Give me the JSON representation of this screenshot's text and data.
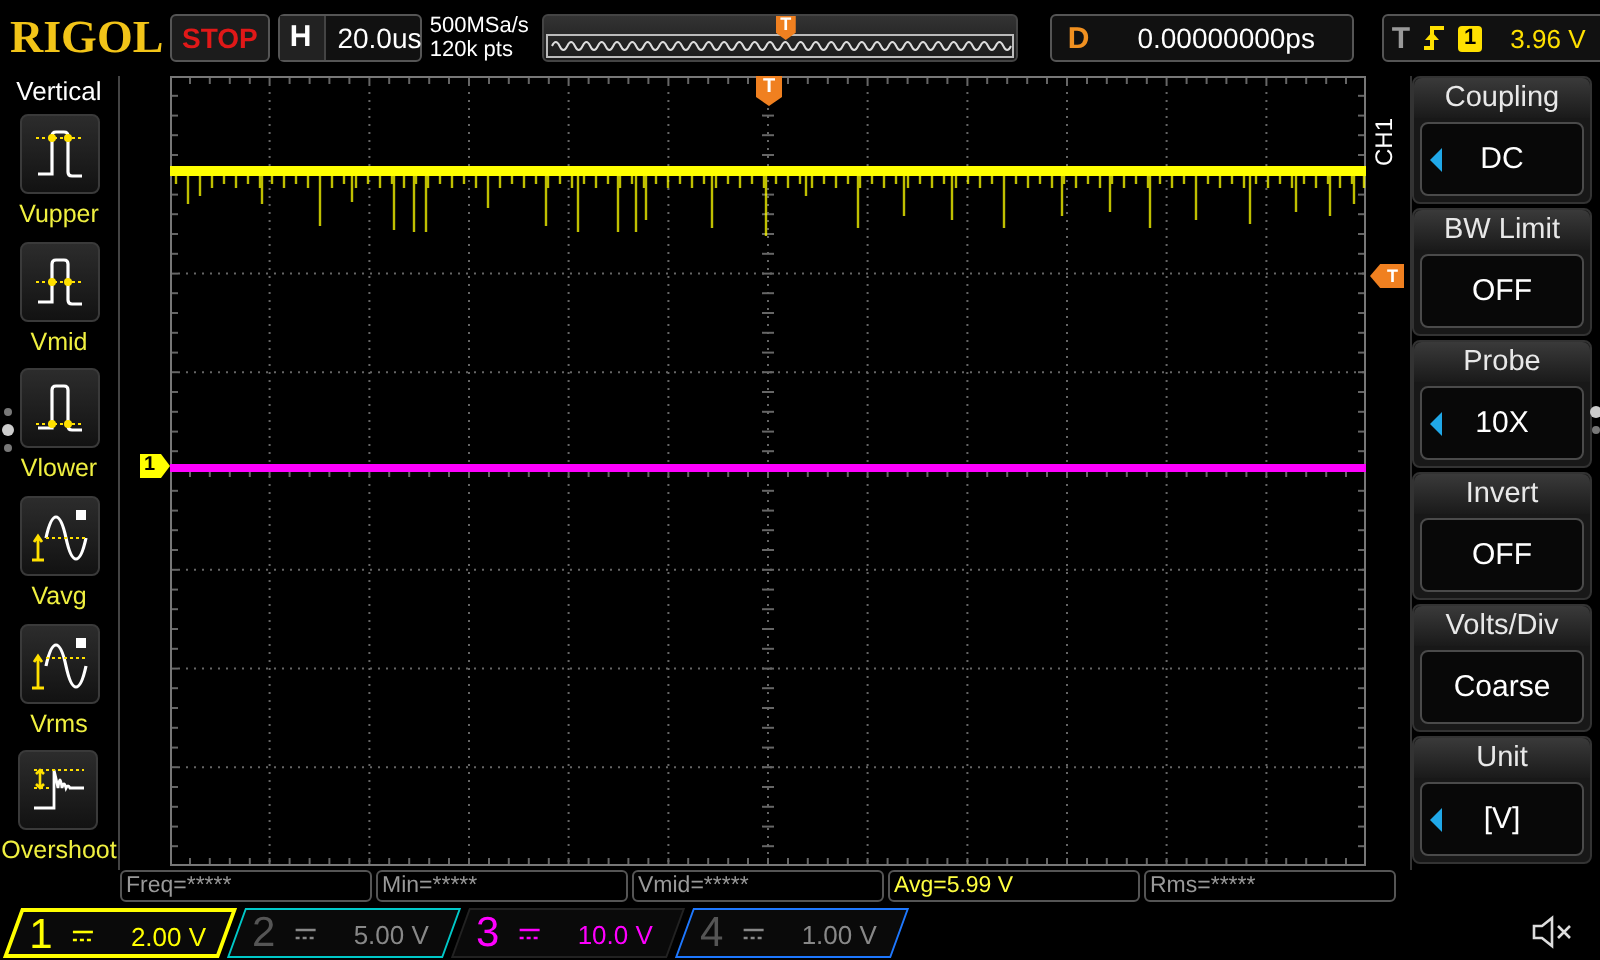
{
  "logo": "RIGOL",
  "run_state": {
    "label": "STOP",
    "stopped": true
  },
  "horizontal": {
    "label": "H",
    "value": "20.0us"
  },
  "acquisition": {
    "sample_rate": "500MSa/s",
    "memory_depth": "120k pts"
  },
  "memory_overview": {
    "trigger_marker": "T"
  },
  "delay": {
    "label": "D",
    "value": "0.00000000ps"
  },
  "trigger": {
    "label": "T",
    "source": "1",
    "value": "3.96 V"
  },
  "left_menu": {
    "title": "Vertical",
    "items": [
      {
        "label": "Vupper",
        "kind": "upper"
      },
      {
        "label": "Vmid",
        "kind": "mid"
      },
      {
        "label": "Vlower",
        "kind": "lower"
      },
      {
        "label": "Vavg",
        "kind": "avg"
      },
      {
        "label": "Vrms",
        "kind": "rms"
      },
      {
        "label": "Overshoot",
        "kind": "overshoot"
      }
    ]
  },
  "screen": {
    "channel_marker": "1",
    "top_trigger_marker": "T",
    "side_trigger_marker": "T",
    "channel_label": "CH1"
  },
  "right_menu": {
    "items": [
      {
        "title": "Coupling",
        "value": "DC",
        "adjustable": true
      },
      {
        "title": "BW Limit",
        "value": "OFF",
        "adjustable": false
      },
      {
        "title": "Probe",
        "value": "10X",
        "adjustable": true
      },
      {
        "title": "Invert",
        "value": "OFF",
        "adjustable": false
      },
      {
        "title": "Volts/Div",
        "value": "Coarse",
        "adjustable": false
      },
      {
        "title": "Unit",
        "value": "[V]",
        "adjustable": true
      }
    ]
  },
  "measurements": [
    {
      "text": "Freq=*****",
      "active": false
    },
    {
      "text": "Min=*****",
      "active": false
    },
    {
      "text": "Vmid=*****",
      "active": false
    },
    {
      "text": "Avg=5.99 V",
      "active": true
    },
    {
      "text": "Rms=*****",
      "active": false
    }
  ],
  "channels": [
    {
      "number": "1",
      "scale": "2.00 V",
      "color": "#ffff00",
      "on": true,
      "selected": true
    },
    {
      "number": "2",
      "scale": "5.00 V",
      "color": "#00c8c8",
      "on": false,
      "selected": false
    },
    {
      "number": "3",
      "scale": "10.0 V",
      "color": "#ff00ff",
      "on": true,
      "selected": false
    },
    {
      "number": "4",
      "scale": "1.00 V",
      "color": "#1e78ff",
      "on": false,
      "selected": false
    }
  ],
  "sound": {
    "muted": true
  }
}
